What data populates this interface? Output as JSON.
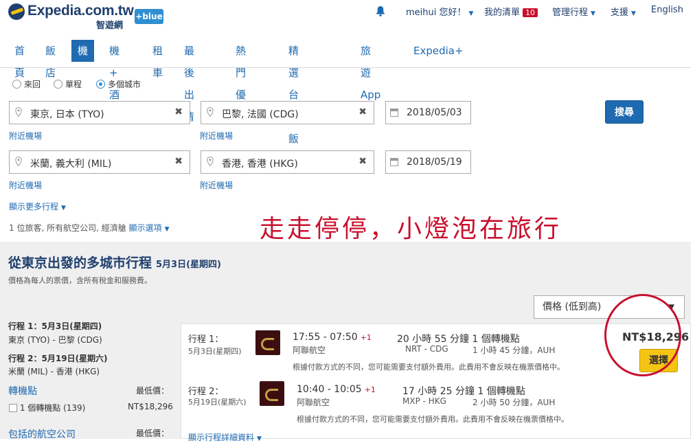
{
  "header": {
    "brand": "Expedia.com.tw",
    "brand_sub": "智遊網",
    "plus_blue": "+blue",
    "user": "meihui 您好！",
    "my_list": "我的清單",
    "my_list_count": "10",
    "manage_trips": "管理行程",
    "support": "支援",
    "language": "English"
  },
  "nav": {
    "items": [
      {
        "label": "首頁"
      },
      {
        "label": "飯店"
      },
      {
        "label": "機票"
      },
      {
        "label": "機 + 酒"
      },
      {
        "label": "租車"
      },
      {
        "label": "最後出清"
      },
      {
        "label": "熱門優惠"
      },
      {
        "label": "精選台灣飯店"
      },
      {
        "label": "旅遊 App"
      },
      {
        "label": "Expedia+"
      }
    ],
    "active_index": 2
  },
  "search": {
    "trip_types": [
      "來回",
      "單程",
      "多個城市"
    ],
    "selected_trip_type": "多個城市",
    "legs": [
      {
        "from": "東京, 日本 (TYO)",
        "to": "巴黎, 法國 (CDG)",
        "date": "2018/05/03"
      },
      {
        "from": "米蘭, 義大利 (MIL)",
        "to": "香港, 香港 (HKG)",
        "date": "2018/05/19"
      }
    ],
    "nearby_airports": "附近機場",
    "more_trips": "顯示更多行程",
    "search_button": "搜尋",
    "travelers_summary": "1 位旅客, 所有航空公司, 經濟艙",
    "show_options": "顯示選項"
  },
  "watermark": "走走停停，小燈泡在旅行",
  "results": {
    "title": "從東京出發的多城市行程",
    "title_date": "5月3日(星期四)",
    "price_note": "價格為每人的票價，含所有稅金和服務費。",
    "sort_value": "價格 (低到高)",
    "sidebar": {
      "leg1_title": "行程 1：5月3日(星期四)",
      "leg1_route": "東京 (TYO) - 巴黎 (CDG)",
      "leg2_title": "行程 2：5月19日(星期六)",
      "leg2_route": "米蘭 (MIL) - 香港 (HKG)",
      "stops_header": "轉機點",
      "lowest_price": "最低價：",
      "one_stop": "1 個轉機點 (139)",
      "one_stop_price": "NT$18,296",
      "airlines_header": "包括的航空公司",
      "lowest_price2": "最低價："
    },
    "card": {
      "legs": [
        {
          "label": "行程 1：",
          "date": "5月3日(星期四)",
          "time": "17:55 - 07:50",
          "day_plus": "+1",
          "airline": "阿聯航空",
          "duration": "20 小時 55 分鐘 1 個轉機點",
          "route": "NRT - CDG",
          "layover": "1 小時 45 分鐘，AUH",
          "disclaimer": "根據付款方式的不同，您可能需要支付額外費用。此費用不會反映在機票價格中。"
        },
        {
          "label": "行程 2：",
          "date": "5月19日(星期六)",
          "time": "10:40 - 10:05",
          "day_plus": "+1",
          "airline": "阿聯航空",
          "duration": "17 小時 25 分鐘 1 個轉機點",
          "route": "MXP - HKG",
          "layover": "2 小時 50 分鐘，AUH",
          "disclaimer": "根據付款方式的不同，您可能需要支付額外費用。此費用不會反映在機票價格中。"
        }
      ],
      "price": "NT$18,296",
      "select_button": "選擇",
      "details_link": "顯示行程詳細資料"
    }
  }
}
